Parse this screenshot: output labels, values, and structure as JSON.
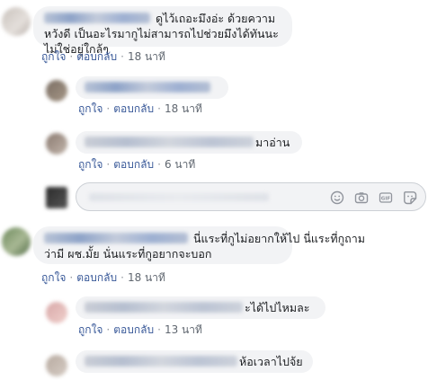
{
  "comments": [
    {
      "text": "ดูไว้เถอะมึงอ่ะ ด้วยความหวังดี เป็นอะไรมากูไม่สามารถไปช่วยมึงได้ทันนะไม่ใช่อยู่ใกล้ๆ",
      "like": "ถูกใจ",
      "reply": "ตอบกลับ",
      "time": "18 นาที",
      "replies": [
        {
          "text": "",
          "like": "ถูกใจ",
          "reply": "ตอบกลับ",
          "time": "18 นาที"
        },
        {
          "text": "มาอ่าน",
          "like": "ถูกใจ",
          "reply": "ตอบกลับ",
          "time": "6 นาที"
        }
      ]
    },
    {
      "text_line1": "นี่แระที่กูไม่อยากให้ไป นี่แระที่กูถาม",
      "text_line2": "ว่ามี ผช.มั้ย นั่นแระที่กูอยากจะบอก",
      "like": "ถูกใจ",
      "reply": "ตอบกลับ",
      "time": "18 นาที",
      "replies": [
        {
          "text": "ะได้ไปไหมละ",
          "like": "ถูกใจ",
          "reply": "ตอบกลับ",
          "time": "13 นาที"
        },
        {
          "text": "ห้อเวลาไปจ้ย"
        }
      ]
    }
  ],
  "composer": {
    "icons": [
      "emoji-icon",
      "camera-icon",
      "gif-icon",
      "sticker-icon"
    ]
  },
  "separator": "·",
  "colors": {
    "link": "#385898",
    "bubble": "#f2f3f5",
    "meta": "#606770"
  }
}
